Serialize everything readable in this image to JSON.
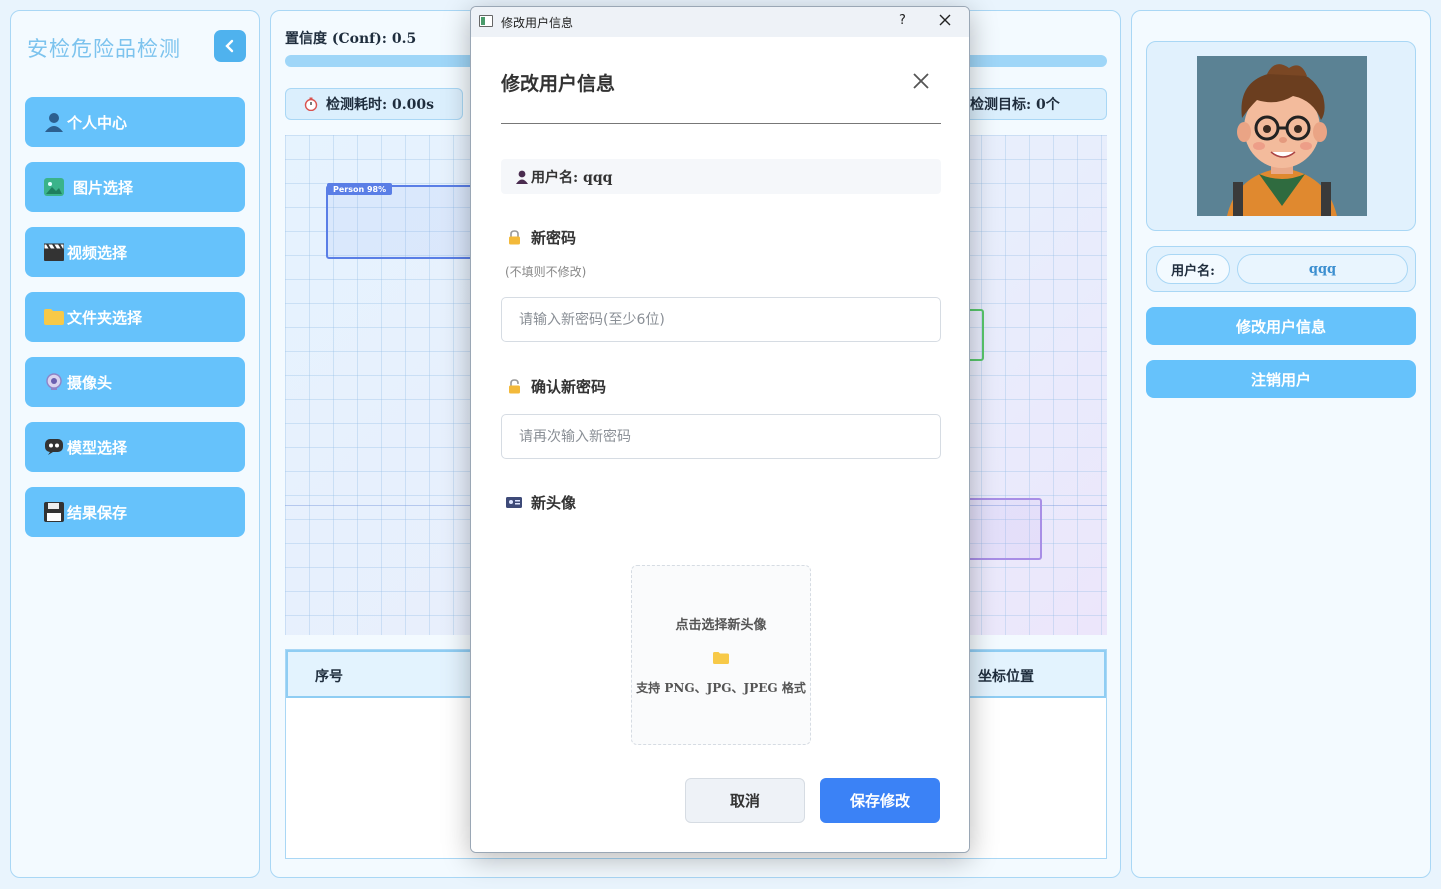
{
  "app": {
    "title": "安检危险品检测"
  },
  "sidebar": {
    "items": [
      {
        "label": "个人中心",
        "icon": "user-icon"
      },
      {
        "label": "图片选择",
        "icon": "image-icon"
      },
      {
        "label": "视频选择",
        "icon": "clapperboard-icon"
      },
      {
        "label": "文件夹选择",
        "icon": "folder-icon"
      },
      {
        "label": "摄像头",
        "icon": "webcam-icon"
      },
      {
        "label": "模型选择",
        "icon": "model-icon"
      },
      {
        "label": "结果保存",
        "icon": "save-icon"
      }
    ]
  },
  "main": {
    "confidence_label": "置信度 (Conf): 0.5",
    "confidence_value": 0.5,
    "elapsed_label": "检测耗时: 0.00s",
    "targets_label": "检测目标: 0个",
    "detection_tag": "Person 98%",
    "table": {
      "col_index": "序号",
      "col_position": "坐标位置"
    }
  },
  "profile": {
    "username_label": "用户名:",
    "username_value": "qqq",
    "edit_button": "修改用户信息",
    "logout_button": "注销用户"
  },
  "dialog": {
    "window_title": "修改用户信息",
    "help": "?",
    "heading": "修改用户信息",
    "username_text": "用户名: qqq",
    "new_password_label": "新密码",
    "hint": "(不填则不修改)",
    "new_password_placeholder": "请输入新密码(至少6位)",
    "confirm_password_label": "确认新密码",
    "confirm_password_placeholder": "请再次输入新密码",
    "new_avatar_label": "新头像",
    "upload_title": "点击选择新头像",
    "upload_formats": "支持 PNG、JPG、JPEG 格式",
    "cancel_button": "取消",
    "save_button": "保存修改"
  },
  "colors": {
    "accent": "#66c2fb",
    "primary_button": "#3b82f6",
    "title": "#7cc3ee"
  }
}
